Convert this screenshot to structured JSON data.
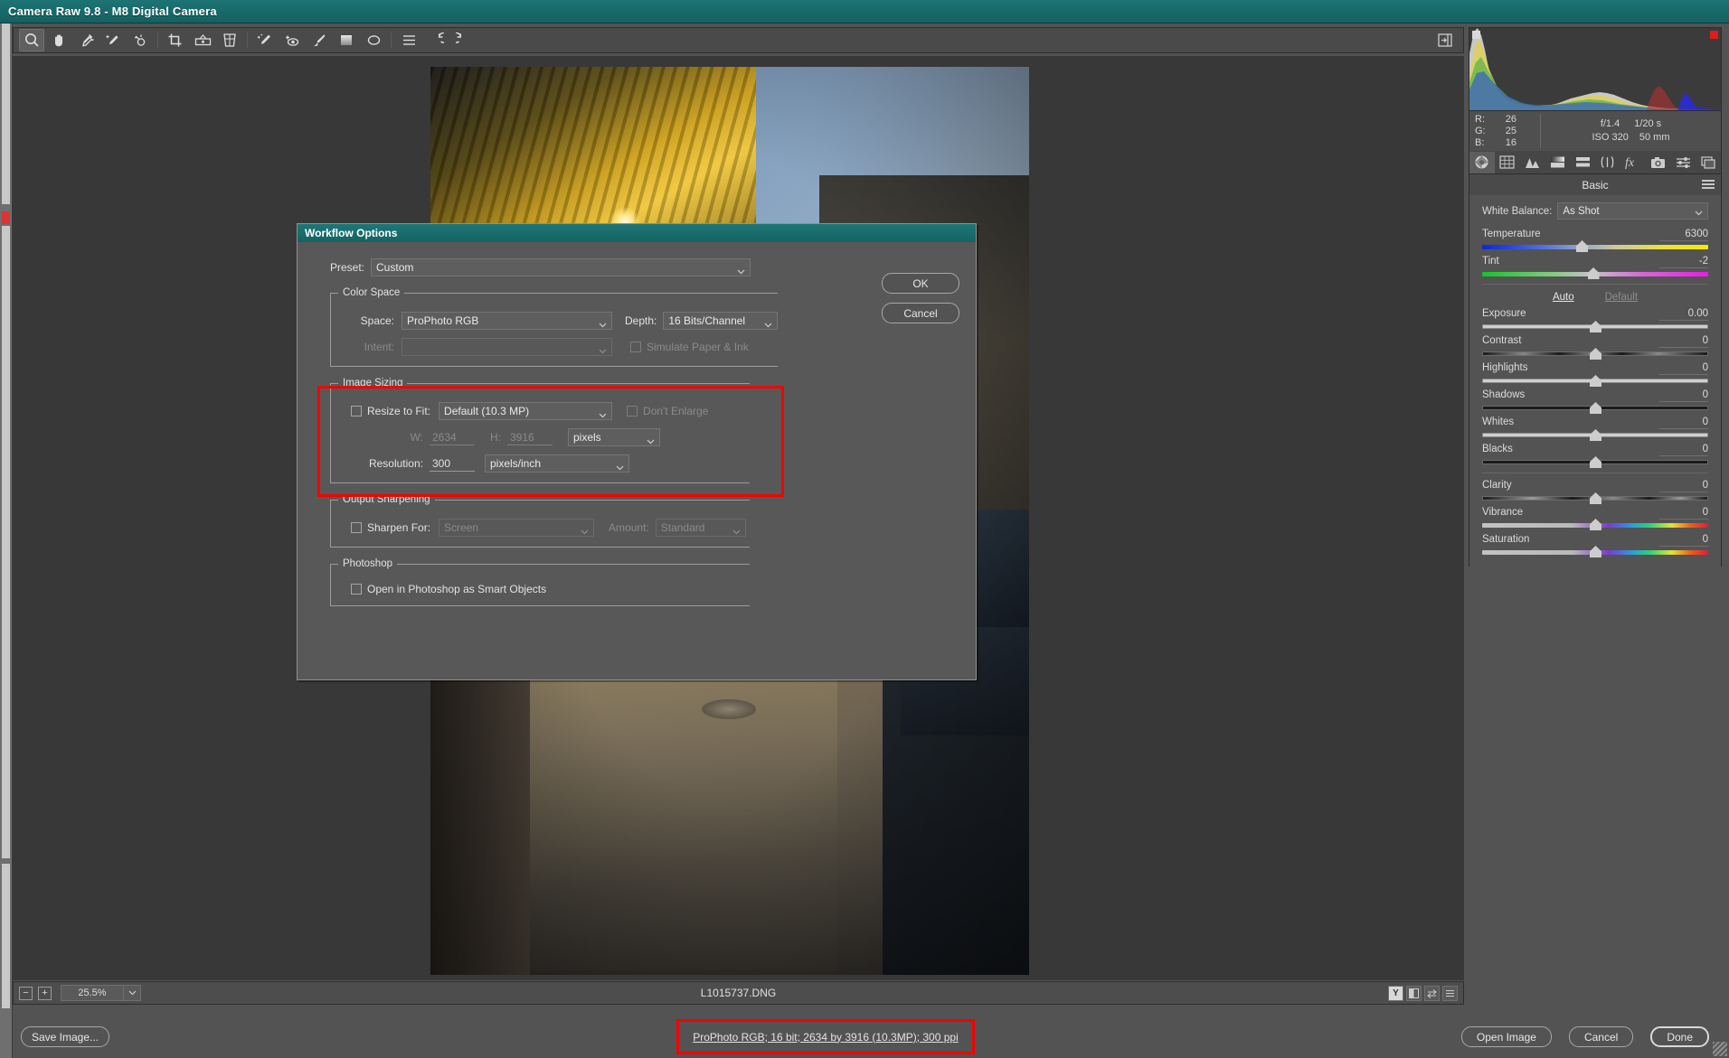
{
  "window": {
    "title": "Camera Raw 9.8  -  M8 Digital Camera"
  },
  "toolbar": {
    "tools": [
      {
        "name": "zoom-tool",
        "label": "Zoom"
      },
      {
        "name": "hand-tool",
        "label": "Hand"
      },
      {
        "name": "white-balance-tool",
        "label": "White Balance"
      },
      {
        "name": "color-sampler-tool",
        "label": "Color Sampler"
      },
      {
        "name": "targeted-adjustment-tool",
        "label": "Targeted Adjustment"
      },
      {
        "name": "crop-tool",
        "label": "Crop"
      },
      {
        "name": "straighten-tool",
        "label": "Straighten"
      },
      {
        "name": "transform-tool",
        "label": "Transform"
      },
      {
        "name": "spot-removal-tool",
        "label": "Spot Removal"
      },
      {
        "name": "red-eye-removal-tool",
        "label": "Red Eye Removal"
      },
      {
        "name": "adjustment-brush-tool",
        "label": "Adjustment Brush"
      },
      {
        "name": "graduated-filter-tool",
        "label": "Graduated Filter"
      },
      {
        "name": "radial-filter-tool",
        "label": "Radial Filter"
      },
      {
        "name": "preferences-tool",
        "label": "Open Preferences Dialog"
      },
      {
        "name": "rotate-left-tool",
        "label": "Rotate Image Counterclockwise"
      },
      {
        "name": "rotate-right-tool",
        "label": "Rotate Image Clockwise"
      }
    ],
    "toggle_filmstrip_label": "Toggle Filmstrip"
  },
  "statusbar": {
    "zoom_out_label": "−",
    "zoom_in_label": "+",
    "zoom_level": "25.5%",
    "filename": "L1015737.DNG",
    "right_icons": [
      {
        "name": "highlight-clipping-icon",
        "label": "Y"
      },
      {
        "name": "before-after-icon",
        "label": ""
      },
      {
        "name": "swap-before-after-icon",
        "label": ""
      },
      {
        "name": "preview-settings-icon",
        "label": ""
      }
    ]
  },
  "right_panel": {
    "readout": {
      "r_label": "R:",
      "r_value": "26",
      "g_label": "G:",
      "g_value": "25",
      "b_label": "B:",
      "b_value": "16"
    },
    "exif": {
      "aperture": "f/1.4",
      "shutter": "1/20 s",
      "iso": "ISO 320",
      "focal_length": "50 mm"
    },
    "tabs": [
      {
        "name": "tab-basic",
        "icon": "aperture-icon",
        "active": true
      },
      {
        "name": "tab-tone-curve",
        "icon": "tone-curve-icon",
        "active": false
      },
      {
        "name": "tab-detail",
        "icon": "detail-triangles-icon",
        "active": false
      },
      {
        "name": "tab-hsl-grayscale",
        "icon": "hsl-icon",
        "active": false
      },
      {
        "name": "tab-split-toning",
        "icon": "split-toning-icon",
        "active": false
      },
      {
        "name": "tab-lens-corrections",
        "icon": "lens-corrections-icon",
        "active": false
      },
      {
        "name": "tab-effects",
        "icon": "fx-icon",
        "active": false
      },
      {
        "name": "tab-camera-calibration",
        "icon": "camera-icon",
        "active": false
      },
      {
        "name": "tab-presets",
        "icon": "presets-sliders-icon",
        "active": false
      },
      {
        "name": "tab-snapshots",
        "icon": "snapshots-icon",
        "active": false
      }
    ],
    "panel_title": "Basic",
    "white_balance": {
      "label": "White Balance:",
      "value": "As Shot"
    },
    "auto_label": "Auto",
    "default_label": "Default",
    "sliders": [
      {
        "name": "temperature",
        "label": "Temperature",
        "value": "6300",
        "pos": 44,
        "track": "temp"
      },
      {
        "name": "tint",
        "label": "Tint",
        "value": "-2",
        "pos": 49,
        "track": "tint"
      },
      {
        "name": "exposure",
        "label": "Exposure",
        "value": "0.00",
        "pos": 50,
        "track": "plain"
      },
      {
        "name": "contrast",
        "label": "Contrast",
        "value": "0",
        "pos": 50,
        "track": "contrast"
      },
      {
        "name": "highlights",
        "label": "Highlights",
        "value": "0",
        "pos": 50,
        "track": "plain"
      },
      {
        "name": "shadows",
        "label": "Shadows",
        "value": "0",
        "pos": 50,
        "track": "dark"
      },
      {
        "name": "whites",
        "label": "Whites",
        "value": "0",
        "pos": 50,
        "track": "plain"
      },
      {
        "name": "blacks",
        "label": "Blacks",
        "value": "0",
        "pos": 50,
        "track": "dark"
      },
      {
        "name": "clarity",
        "label": "Clarity",
        "value": "0",
        "pos": 50,
        "track": "clarity"
      },
      {
        "name": "vibrance",
        "label": "Vibrance",
        "value": "0",
        "pos": 50,
        "track": "vib"
      },
      {
        "name": "saturation",
        "label": "Saturation",
        "value": "0",
        "pos": 50,
        "track": "vib"
      }
    ]
  },
  "dialog": {
    "title": "Workflow Options",
    "preset": {
      "label": "Preset:",
      "value": "Custom"
    },
    "ok_label": "OK",
    "cancel_label": "Cancel",
    "color_space": {
      "legend": "Color Space",
      "space_label": "Space:",
      "space_value": "ProPhoto RGB",
      "depth_label": "Depth:",
      "depth_value": "16 Bits/Channel",
      "intent_label": "Intent:",
      "intent_value": "",
      "simulate_label": "Simulate Paper & Ink"
    },
    "image_sizing": {
      "legend": "Image Sizing",
      "resize_label": "Resize to Fit:",
      "resize_value": "Default  (10.3 MP)",
      "dont_enlarge_label": "Don't Enlarge",
      "w_label": "W:",
      "w_value": "2634",
      "h_label": "H:",
      "h_value": "3916",
      "units_value": "pixels",
      "resolution_label": "Resolution:",
      "resolution_value": "300",
      "resolution_units": "pixels/inch"
    },
    "output_sharpening": {
      "legend": "Output Sharpening",
      "sharpen_label": "Sharpen For:",
      "sharpen_value": "Screen",
      "amount_label": "Amount:",
      "amount_value": "Standard"
    },
    "photoshop": {
      "legend": "Photoshop",
      "smart_objects_label": "Open in Photoshop as Smart Objects"
    }
  },
  "footer": {
    "save_image_label": "Save Image...",
    "summary_link": "ProPhoto RGB; 16 bit; 2634 by 3916 (10.3MP); 300 ppi",
    "open_image_label": "Open Image",
    "cancel_label": "Cancel",
    "done_label": "Done"
  },
  "colors": {
    "title_bar": "#176666",
    "highlight": "#f50000",
    "panel_bg": "#535353"
  }
}
